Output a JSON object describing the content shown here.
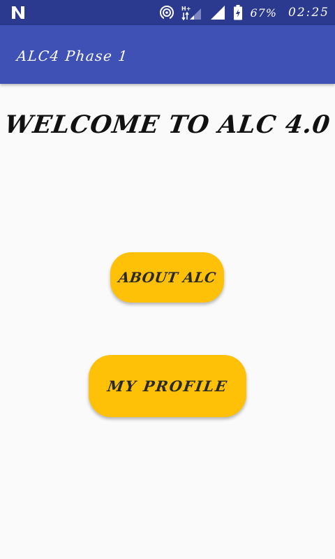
{
  "status_bar": {
    "battery_percent": "67%",
    "time": "02:25",
    "icons": [
      "n-notification-icon",
      "hotspot-icon",
      "mobile-data-hplus-icon",
      "signal-icon",
      "battery-charging-icon"
    ]
  },
  "app_bar": {
    "title": "ALC4 Phase 1"
  },
  "main": {
    "welcome": "WELCOME TO ALC 4.0",
    "about_button": "ABOUT ALC",
    "profile_button": "MY PROFILE"
  },
  "colors": {
    "status_bar": "#2b3a8f",
    "app_bar": "#3f51b5",
    "button": "#ffc107",
    "background": "#fafafa"
  }
}
